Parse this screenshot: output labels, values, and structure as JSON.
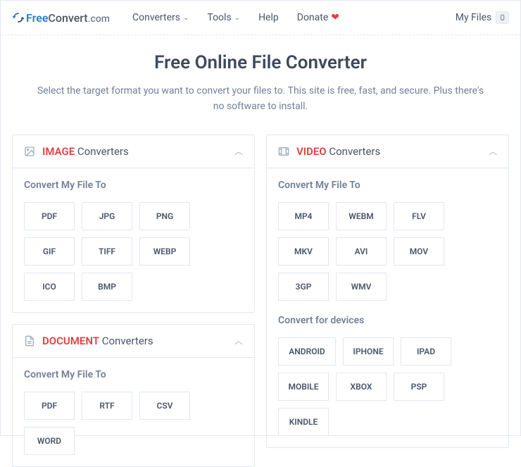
{
  "logo": {
    "part1": "Free",
    "part2": "Convert",
    "part3": ".com"
  },
  "nav": {
    "converters": "Converters",
    "tools": "Tools",
    "help": "Help",
    "donate": "Donate",
    "myfiles": "My Files",
    "fileCount": "0"
  },
  "hero": {
    "title": "Free Online File Converter",
    "subtitle": "Select the target format you want to convert your files to. This site is free, fast, and secure. Plus there's no software to install."
  },
  "labels": {
    "convertTo": "Convert My File To",
    "convertDevices": "Convert for devices",
    "convertersSuffix": " Converters"
  },
  "cards": {
    "image": {
      "category": "IMAGE",
      "formats": [
        "PDF",
        "JPG",
        "PNG",
        "GIF",
        "TIFF",
        "WEBP",
        "ICO",
        "BMP"
      ]
    },
    "document": {
      "category": "DOCUMENT",
      "formats": [
        "PDF",
        "RTF",
        "CSV",
        "WORD"
      ]
    },
    "video": {
      "category": "VIDEO",
      "formats": [
        "MP4",
        "WEBM",
        "FLV",
        "MKV",
        "AVI",
        "MOV",
        "3GP",
        "WMV"
      ],
      "devices": [
        "ANDROID",
        "IPHONE",
        "IPAD",
        "MOBILE",
        "XBOX",
        "PSP",
        "KINDLE"
      ]
    }
  }
}
